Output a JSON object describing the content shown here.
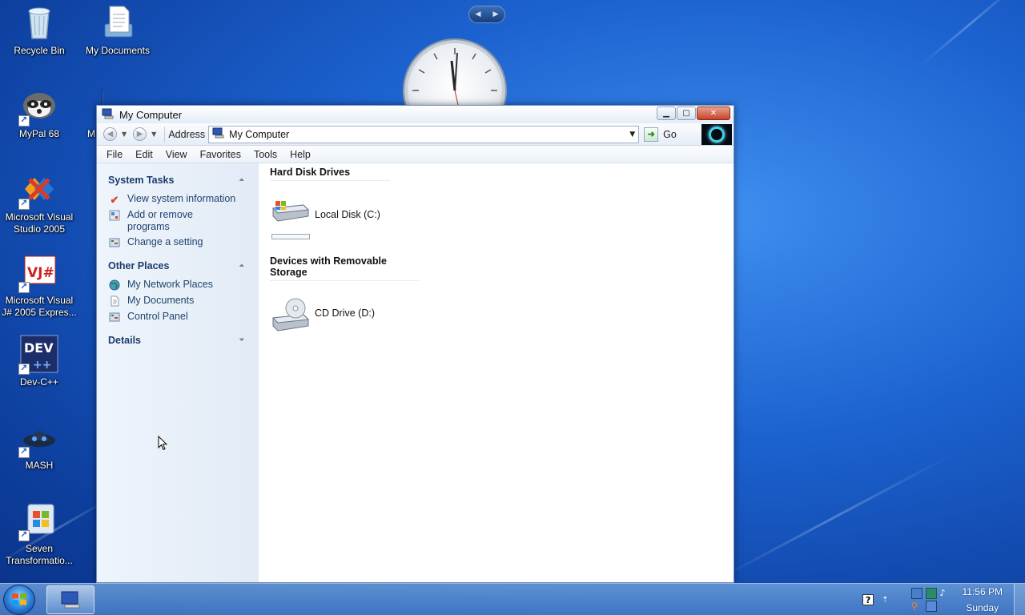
{
  "desktop": {
    "icons": [
      {
        "label": "Recycle Bin",
        "icon": "recycle-bin-icon"
      },
      {
        "label": "My Documents",
        "icon": "documents-icon"
      },
      {
        "label": "MyPal 68",
        "icon": "mypal-icon"
      },
      {
        "label": "Microsoft Visual Studio 2005",
        "icon": "visual-studio-icon"
      },
      {
        "label": "Microsoft Visual J# 2005 Expres...",
        "icon": "visual-jsharp-icon"
      },
      {
        "label": "Dev-C++",
        "icon": "devcpp-icon"
      },
      {
        "label": "MASH",
        "icon": "mash-icon"
      },
      {
        "label": "Seven Transformatio...",
        "icon": "seven-transformation-icon"
      },
      {
        "label": "M",
        "icon": "computer-icon"
      }
    ]
  },
  "window": {
    "title": "My Computer",
    "toolbar": {
      "address_label": "Address",
      "address_value": "My Computer",
      "go_label": "Go"
    },
    "menu": [
      "File",
      "Edit",
      "View",
      "Favorites",
      "Tools",
      "Help"
    ],
    "taskpane": {
      "system_tasks": {
        "title": "System Tasks",
        "items": [
          "View system information",
          "Add or remove programs",
          "Change a setting"
        ]
      },
      "other_places": {
        "title": "Other Places",
        "items": [
          "My Network Places",
          "My Documents",
          "Control Panel"
        ]
      },
      "details": {
        "title": "Details"
      }
    },
    "content": {
      "hard_disk_title": "Hard Disk Drives",
      "local_disk": "Local Disk (C:)",
      "local_disk_used_fraction": 0.0,
      "removable_title": "Devices with Removable Storage",
      "cd_drive": "CD Drive (D:)"
    }
  },
  "taskbar": {
    "time": "11:56 PM",
    "day": "Sunday"
  },
  "colors": {
    "desktop_blue": "#1c62cf",
    "taskpane_link": "#20446f",
    "close_red": "#c7432a"
  }
}
